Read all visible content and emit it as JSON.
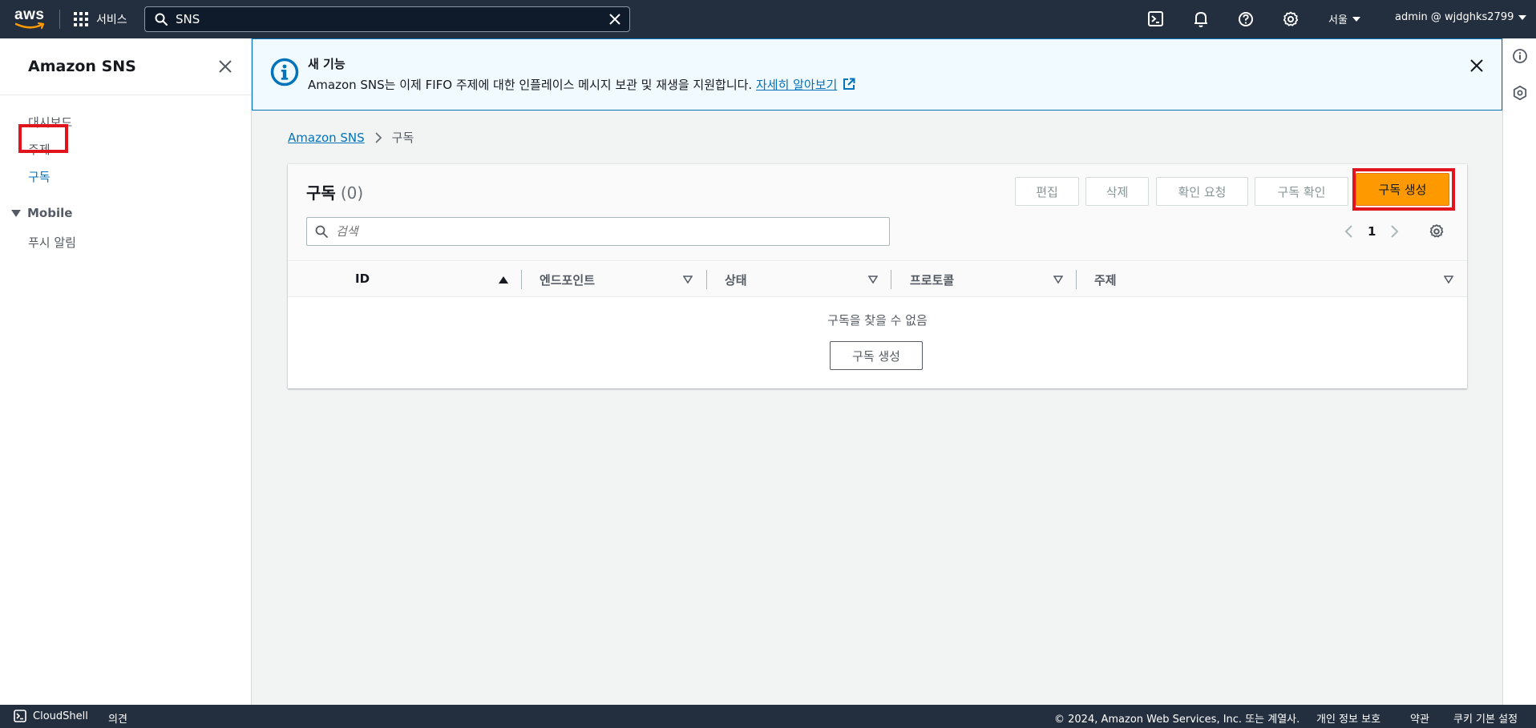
{
  "topnav": {
    "logo_text": "aws",
    "services_label": "서비스",
    "search_value": "SNS",
    "region_label": "서울",
    "account_label": "admin @ wjdghks2799"
  },
  "sidenav": {
    "title": "Amazon SNS",
    "items": [
      {
        "label": "대시보드"
      },
      {
        "label": "주제"
      },
      {
        "label": "구독"
      }
    ],
    "section_label": "Mobile",
    "section_items": [
      {
        "label": "푸시 알림"
      }
    ]
  },
  "flash": {
    "heading": "새 기능",
    "message": "Amazon SNS는 이제 FIFO 주제에 대한 인플레이스 메시지 보관 및 재생을 지원합니다. ",
    "link": "자세히 알아보기"
  },
  "breadcrumb": {
    "root": "Amazon SNS",
    "current": "구독"
  },
  "panel": {
    "title": "구독",
    "count": "(0)",
    "buttons": {
      "edit": "편집",
      "delete": "삭제",
      "request_confirm": "확인 요청",
      "confirm": "구독 확인",
      "create": "구독 생성"
    },
    "search_placeholder": "검색",
    "page_number": "1",
    "columns": [
      "ID",
      "엔드포인트",
      "상태",
      "프로토콜",
      "주제"
    ],
    "empty_message": "구독을 찾을 수 없음",
    "empty_button": "구독 생성"
  },
  "footer": {
    "cloudshell": "CloudShell",
    "feedback": "의견",
    "copyright": "© 2024, Amazon Web Services, Inc. 또는 계열사.",
    "privacy": "개인 정보 보호",
    "terms": "약관",
    "cookies": "쿠키 기본 설정"
  },
  "colors": {
    "nav_bg": "#232f3e",
    "accent_orange": "#ff9900",
    "link_blue": "#0073bb",
    "highlight_red": "#e0141d"
  }
}
